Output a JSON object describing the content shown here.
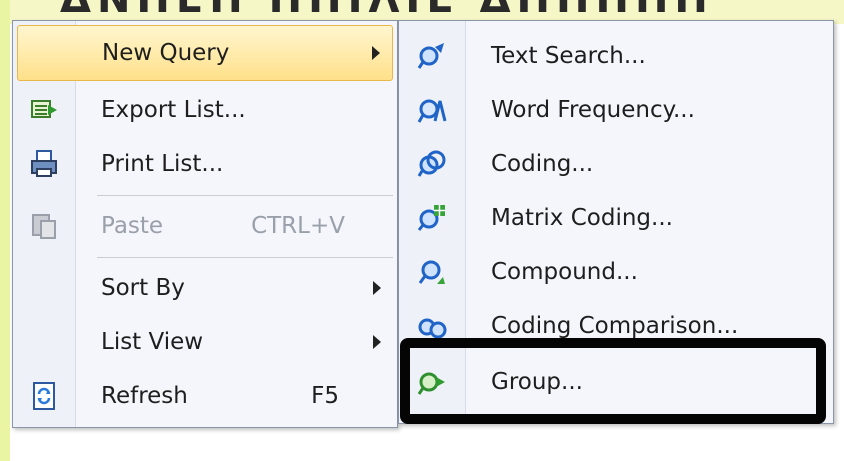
{
  "background": {
    "ghost_text": "ΔΝΠΕΠ ΠΠΙΛΙΕ ΔΠΠΠΠΠ"
  },
  "main_menu": {
    "items": [
      {
        "label": "New Query",
        "icon": null,
        "submenu": true
      },
      {
        "label": "Export List...",
        "icon": "export-list-icon"
      },
      {
        "label": "Print List...",
        "icon": "print-icon"
      },
      {
        "label": "Paste",
        "shortcut": "CTRL+V",
        "icon": "paste-icon",
        "disabled": true
      },
      {
        "label": "Sort By",
        "submenu": true
      },
      {
        "label": "List View",
        "submenu": true
      },
      {
        "label": "Refresh",
        "shortcut": "F5",
        "icon": "refresh-icon"
      }
    ]
  },
  "sub_menu": {
    "items": [
      {
        "label": "Text Search...",
        "icon": "text-search-icon"
      },
      {
        "label": "Word Frequency...",
        "icon": "word-frequency-icon"
      },
      {
        "label": "Coding...",
        "icon": "coding-icon"
      },
      {
        "label": "Matrix Coding...",
        "icon": "matrix-coding-icon"
      },
      {
        "label": "Compound...",
        "icon": "compound-icon"
      },
      {
        "label": "Coding Comparison...",
        "icon": "coding-comparison-icon"
      },
      {
        "label": "Group...",
        "icon": "group-icon"
      }
    ]
  },
  "colors": {
    "highlight": "#ffe08a",
    "focus_box": "#050505"
  }
}
